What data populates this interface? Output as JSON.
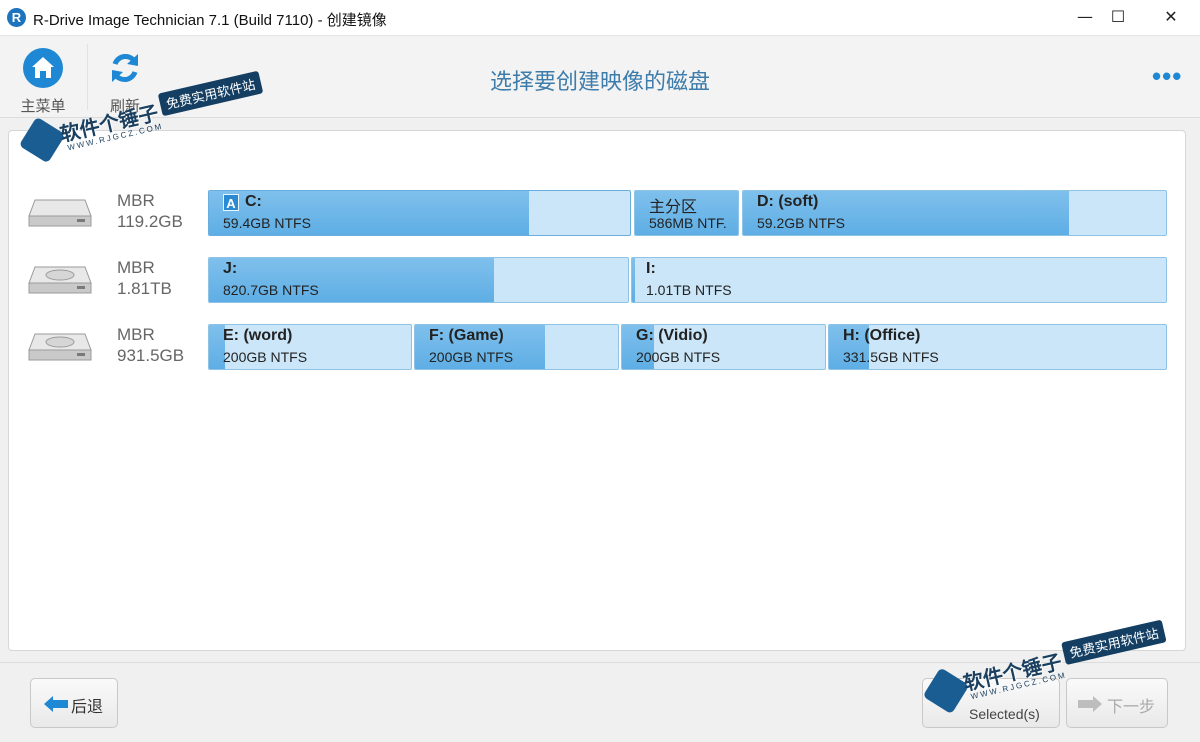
{
  "window": {
    "logo_letter": "R",
    "title": "R-Drive Image Technician 7.1 (Build 7110) - 创建镜像",
    "minimize_glyph": "—",
    "maximize_glyph": "☐",
    "close_glyph": "✕"
  },
  "toolbar": {
    "main_menu_label": "主菜单",
    "refresh_label": "刷新",
    "heading": "选择要创建映像的磁盘",
    "more_glyph": "•••",
    "home_icon": "home-icon",
    "refresh_icon": "refresh-icon"
  },
  "disks": [
    {
      "scheme": "MBR",
      "size": "119.2GB",
      "partitions": [
        {
          "name": "C:",
          "size": "59.4GB NTFS",
          "used_fraction": 0.76,
          "system": true,
          "system_letter": "A"
        },
        {
          "name": "主分区",
          "size": "586MB NTF.",
          "used_fraction": 1.0
        },
        {
          "name": "D: (soft)",
          "size": "59.2GB NTFS",
          "used_fraction": 0.77
        }
      ]
    },
    {
      "scheme": "MBR",
      "size": "1.81TB",
      "partitions": [
        {
          "name": "J:",
          "size": "820.7GB NTFS",
          "used_fraction": 0.68
        },
        {
          "name": "I:",
          "size": "1.01TB NTFS",
          "used_fraction": 0.005
        }
      ]
    },
    {
      "scheme": "MBR",
      "size": "931.5GB",
      "partitions": [
        {
          "name": "E: (word)",
          "size": "200GB NTFS",
          "used_fraction": 0.08
        },
        {
          "name": "F: (Game)",
          "size": "200GB NTFS",
          "used_fraction": 0.64
        },
        {
          "name": "G: (Vidio)",
          "size": "200GB NTFS",
          "used_fraction": 0.16
        },
        {
          "name": "H: (Office)",
          "size": "331.5GB NTFS",
          "used_fraction": 0.12
        }
      ]
    }
  ],
  "footer": {
    "back_label": "后退",
    "selected_label": "Selected(s)",
    "next_label": "下一步"
  },
  "watermark": {
    "title": "软件个锤子",
    "url": "WWW.RJGCZ.COM",
    "tagline": "免费实用软件站"
  },
  "colors": {
    "accent": "#1e88d4",
    "heading": "#3e7cab",
    "partition_fill": "#6db8ea",
    "partition_free": "#cbe6f8"
  }
}
